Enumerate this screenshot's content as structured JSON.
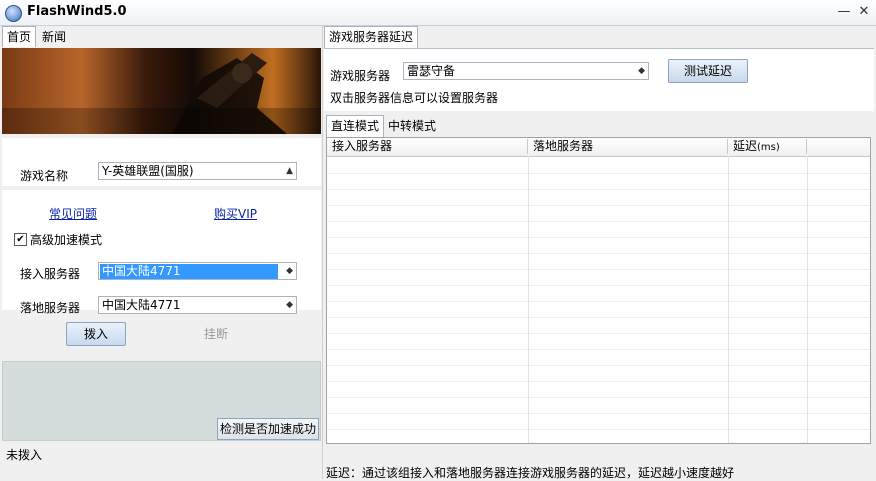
{
  "window": {
    "title": "FlashWind5.0"
  },
  "left": {
    "tabs": [
      {
        "label": "首页"
      },
      {
        "label": "新闻"
      }
    ],
    "game_label": "游戏名称",
    "game_value": "Y-英雄联盟(国服)",
    "link_faq": "常见问题",
    "link_vip": "购买VIP",
    "advanced_mode": "高级加速模式",
    "access_label": "接入服务器",
    "access_value": "中国大陆4771",
    "landing_label": "落地服务器",
    "landing_value": "中国大陆4771",
    "connect_btn": "拨入",
    "hangup_btn": "挂断",
    "check_btn": "检测是否加速成功",
    "status": "未拨入"
  },
  "right": {
    "tab": "游戏服务器延迟",
    "server_label": "游戏服务器",
    "server_value": "雷瑟守备",
    "test_btn": "测试延迟",
    "hint": "双击服务器信息可以设置服务器",
    "mode_tabs": [
      {
        "label": "直连模式"
      },
      {
        "label": "中转模式"
      }
    ],
    "columns": {
      "access": "接入服务器",
      "landing": "落地服务器",
      "latency": "延迟",
      "latency_unit": "(ms)"
    },
    "footer": "延迟：通过该组接入和落地服务器连接游戏服务器的延迟，延迟越小速度越好"
  },
  "icons": {
    "app": "flashwind-logo-icon",
    "minimize": "minimize-icon",
    "close": "close-icon",
    "checkbox": "checkbox-checked-icon",
    "dropdown": "dropdown-arrow-icon"
  },
  "colors": {
    "selection": "#3399ff",
    "link": "#0b24a8"
  }
}
